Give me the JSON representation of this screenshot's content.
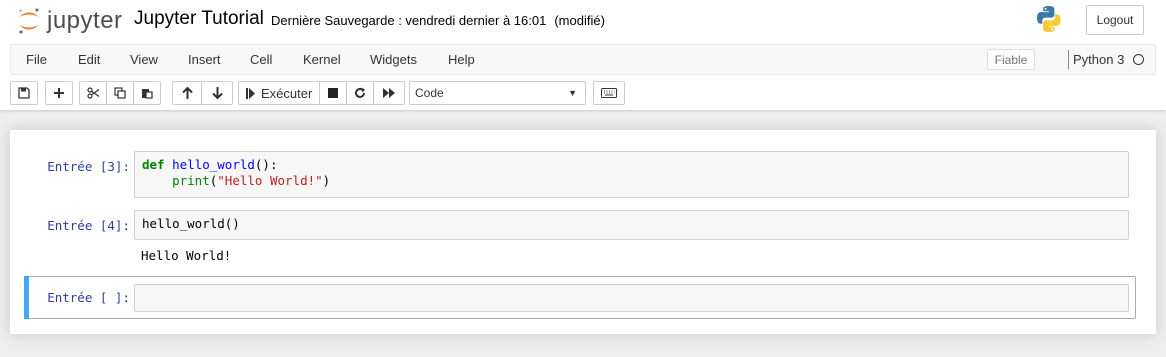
{
  "header": {
    "logo_text": "jupyter",
    "notebook_title": "Jupyter Tutorial",
    "save_status": "Dernière Sauvegarde : vendredi dernier à 16:01",
    "modified": "(modifié)",
    "logout_label": "Logout"
  },
  "menubar": {
    "items": [
      "File",
      "Edit",
      "View",
      "Insert",
      "Cell",
      "Kernel",
      "Widgets",
      "Help"
    ],
    "trusted_label": "Fiable",
    "kernel_name": "Python 3"
  },
  "toolbar": {
    "run_label": "Exécuter",
    "cell_type": "Code",
    "icons": [
      "save-icon",
      "plus-icon",
      "cut-icon",
      "copy-icon",
      "paste-icon",
      "arrow-up-icon",
      "arrow-down-icon",
      "run-icon",
      "stop-icon",
      "restart-icon",
      "fast-forward-icon",
      "keyboard-icon"
    ]
  },
  "cells": [
    {
      "prompt": "Entrée [3]:",
      "lines": [
        [
          {
            "t": "def",
            "c": "kw"
          },
          {
            "t": " ",
            "c": ""
          },
          {
            "t": "hello_world",
            "c": "fn"
          },
          {
            "t": "():",
            "c": ""
          }
        ],
        [
          {
            "t": "    ",
            "c": ""
          },
          {
            "t": "print",
            "c": "bi"
          },
          {
            "t": "(",
            "c": ""
          },
          {
            "t": "\"Hello World!\"",
            "c": "st"
          },
          {
            "t": ")",
            "c": ""
          }
        ]
      ],
      "output": ""
    },
    {
      "prompt": "Entrée [4]:",
      "lines": [
        [
          {
            "t": "hello_world()",
            "c": ""
          }
        ]
      ],
      "output": "Hello World!"
    },
    {
      "prompt": "Entrée [ ]:",
      "lines": [],
      "output": ""
    }
  ],
  "colors": {
    "prompt": "#303f9f",
    "selected_cell_bar": "#42a5f5",
    "jupyter_orange": "#f37726"
  }
}
